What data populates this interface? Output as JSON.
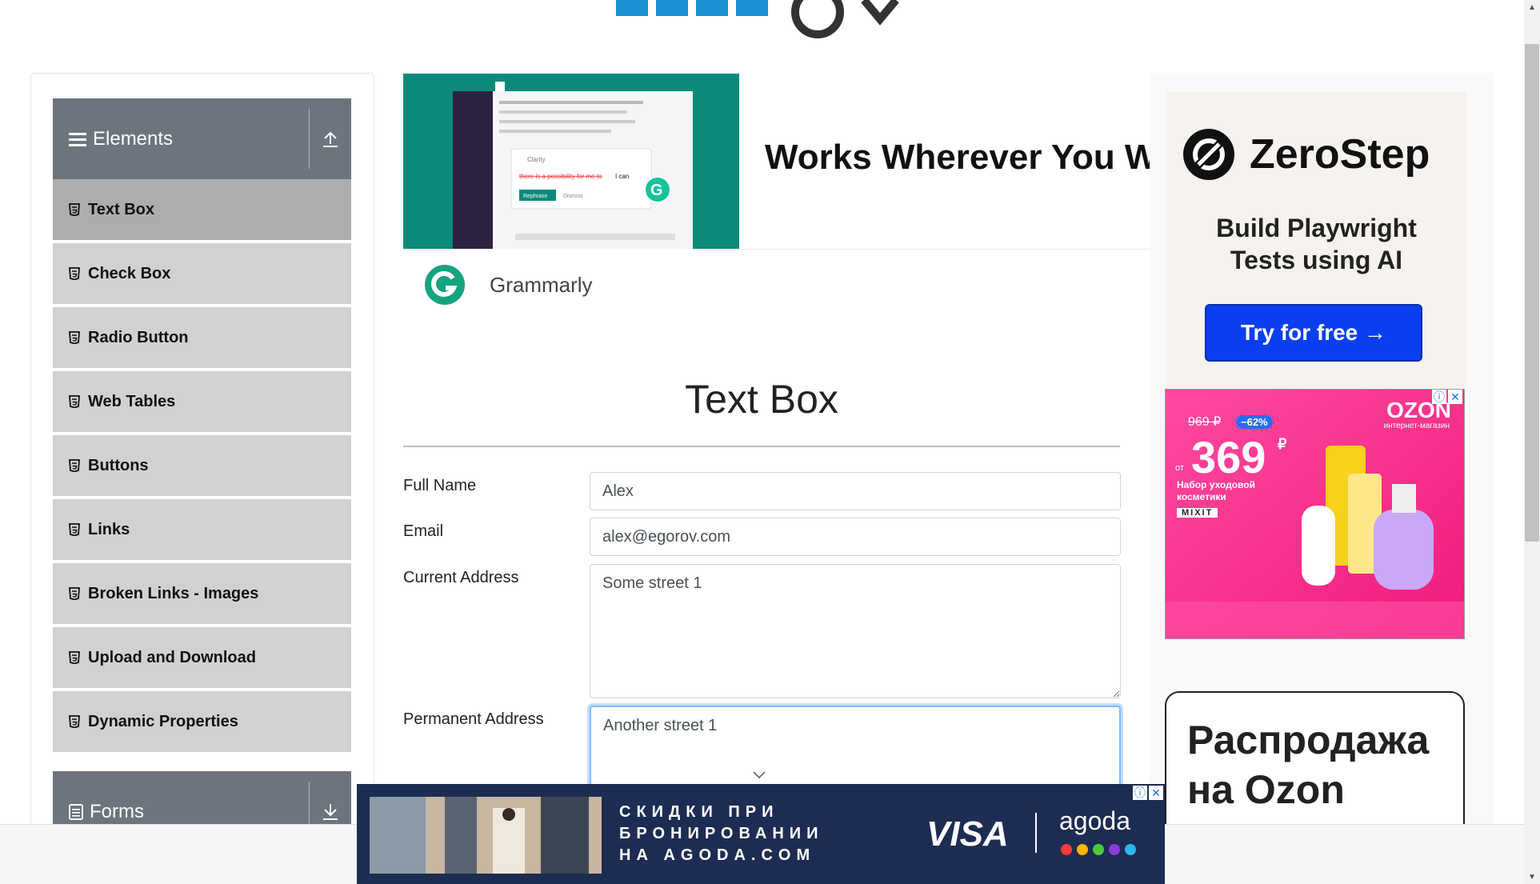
{
  "sidebar": {
    "elements_label": "Elements",
    "forms_label": "Forms",
    "items": [
      {
        "label": "Text Box"
      },
      {
        "label": "Check Box"
      },
      {
        "label": "Radio Button"
      },
      {
        "label": "Web Tables"
      },
      {
        "label": "Buttons"
      },
      {
        "label": "Links"
      },
      {
        "label": "Broken Links - Images"
      },
      {
        "label": "Upload and Download"
      },
      {
        "label": "Dynamic Properties"
      }
    ]
  },
  "banner_ad": {
    "headline": "Works Wherever You Wo",
    "brand": "Grammarly",
    "popup_title": "Clarity",
    "popup_strike": "there is a possibility for me to",
    "popup_fix": "I can",
    "popup_rephrase": "Rephrase",
    "popup_dismiss": "Dismiss"
  },
  "form": {
    "title": "Text Box",
    "full_name_label": "Full Name",
    "full_name_value": "Alex",
    "email_label": "Email",
    "email_value": "alex@egorov.com",
    "current_address_label": "Current Address",
    "current_address_value": "Some street 1",
    "permanent_address_label": "Permanent Address",
    "permanent_address_value": "Another street 1"
  },
  "right_ads": {
    "zerostep_brand": "ZeroStep",
    "zerostep_sub_1": "Build Playwright",
    "zerostep_sub_2": "Tests using AI",
    "zerostep_button": "Try for free →",
    "ozon_logo": "OZON",
    "ozon_tagline": "интернет-магазин",
    "ozon_old_price": "969 ₽",
    "ozon_discount": "−62%",
    "ozon_from": "от",
    "ozon_price": "369",
    "ozon_currency": "₽",
    "ozon_desc_1": "Набор уходовой",
    "ozon_desc_2": "косметики",
    "ozon_brand": "MIXIT",
    "sale_line_1": "Распродажа",
    "sale_line_2": "на Ozon"
  },
  "bottom_ad": {
    "line_1": "СКИДКИ ПРИ",
    "line_2": "БРОНИРОВАНИИ",
    "line_3": "НА AGODA.COM",
    "visa": "VISA",
    "agoda": "agoda"
  },
  "colors": {
    "sidebar_header": "#6c757d",
    "sidebar_item": "#d1d1d1",
    "sidebar_item_active": "#adadad",
    "zerostep_button": "#0a3ff0",
    "ozon_bg": "#ff2f8f",
    "bottom_ad_bg": "#1d2c52",
    "grammarly_green": "#15c39a"
  }
}
